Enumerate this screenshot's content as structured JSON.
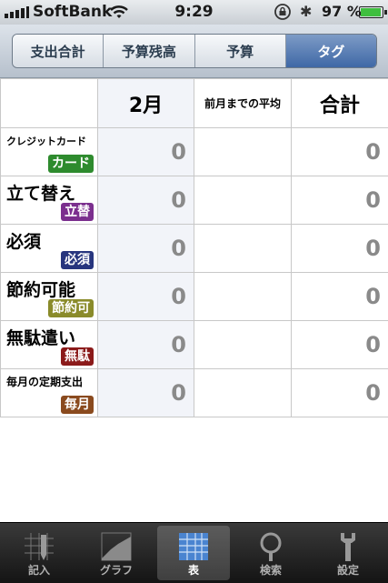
{
  "status_bar": {
    "carrier": "SoftBank",
    "time": "9:29",
    "battery_percent": "97 %",
    "battery_level": 0.97
  },
  "segments": {
    "items": [
      "支出合計",
      "予算残高",
      "予算",
      "タグ"
    ],
    "selected_index": 3
  },
  "table": {
    "columns": [
      "2月",
      "前月までの平均",
      "合計"
    ],
    "rows": [
      {
        "name": "クレジットカード",
        "tag": "カード",
        "tag_color": "#2e8b2e",
        "month": "0",
        "average": "",
        "total": "0"
      },
      {
        "name": "立て替え",
        "tag": "立替",
        "tag_color": "#7b2f8e",
        "month": "0",
        "average": "",
        "total": "0"
      },
      {
        "name": "必須",
        "tag": "必須",
        "tag_color": "#27357e",
        "month": "0",
        "average": "",
        "total": "0"
      },
      {
        "name": "節約可能",
        "tag": "節約可",
        "tag_color": "#8a8b2a",
        "month": "0",
        "average": "",
        "total": "0"
      },
      {
        "name": "無駄遣い",
        "tag": "無駄",
        "tag_color": "#8b1a1a",
        "month": "0",
        "average": "",
        "total": "0"
      },
      {
        "name": "毎月の定期支出",
        "tag": "毎月",
        "tag_color": "#8a4a1e",
        "month": "0",
        "average": "",
        "total": "0"
      }
    ]
  },
  "tab_bar": {
    "items": [
      {
        "label": "記入",
        "icon": "pencil-grid-icon"
      },
      {
        "label": "グラフ",
        "icon": "chart-icon"
      },
      {
        "label": "表",
        "icon": "table-icon"
      },
      {
        "label": "検索",
        "icon": "search-icon"
      },
      {
        "label": "設定",
        "icon": "wrench-icon"
      }
    ],
    "selected_index": 2
  }
}
